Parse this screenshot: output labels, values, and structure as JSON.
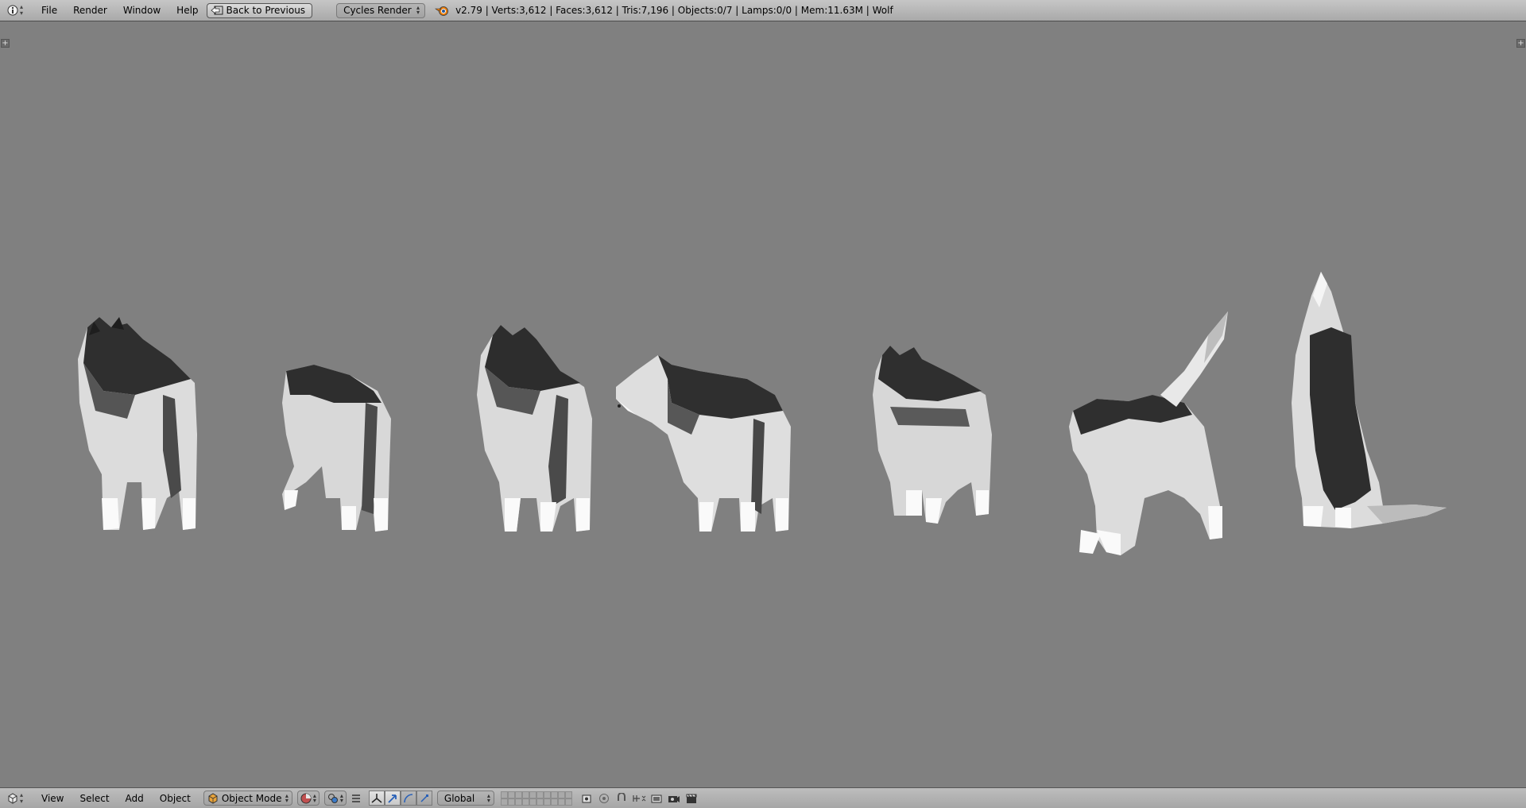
{
  "top": {
    "menus": [
      "File",
      "Render",
      "Window",
      "Help"
    ],
    "back_button": "Back to Previous",
    "render_engine": "Cycles Render",
    "stats": "v2.79 | Verts:3,612 | Faces:3,612 | Tris:7,196 | Objects:0/7 | Lamps:0/0 | Mem:11.63M | Wolf"
  },
  "viewport": {
    "background": "#808080",
    "object_count": 7
  },
  "bottom": {
    "menus": [
      "View",
      "Select",
      "Add",
      "Object"
    ],
    "mode": "Object Mode",
    "orientation": "Global"
  }
}
